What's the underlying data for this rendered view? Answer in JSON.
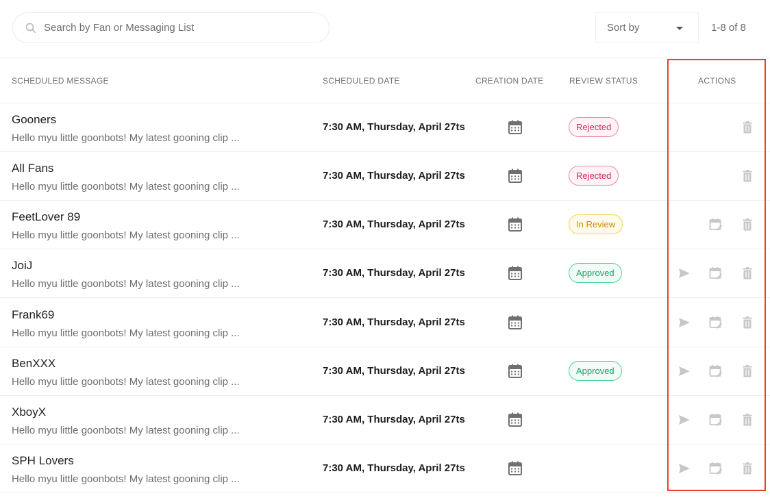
{
  "search": {
    "placeholder": "Search by Fan or Messaging List",
    "value": ""
  },
  "sort": {
    "label": "Sort by"
  },
  "pagination": {
    "text": "1-8 of 8"
  },
  "columns": {
    "message": "SCHEDULED MESSAGE",
    "scheduled_date": "SCHEDULED DATE",
    "creation_date": "CREATION DATE",
    "review_status": "REVIEW STATUS",
    "actions": "ACTIONS"
  },
  "icons": {
    "search": "search-icon",
    "sort": "chevron-down-icon",
    "creation": "calendar-icon",
    "send": "send-icon",
    "reschedule": "calendar-edit-icon",
    "delete": "trash-icon"
  },
  "colors": {
    "rejected": "#d2265a",
    "in_review": "#c98a00",
    "approved": "#12a46a",
    "highlight": "#e8402d",
    "action_icon": "#c7c7c7"
  },
  "rows": [
    {
      "name": "Gooners",
      "message": "Hello myu little goonbots! My latest gooning clip ...",
      "scheduled_date": "7:30 AM, Thursday, April 27ts",
      "status": "Rejected",
      "actions": [
        "trash"
      ]
    },
    {
      "name": "All Fans",
      "message": "Hello myu little goonbots! My latest gooning clip ...",
      "scheduled_date": "7:30 AM, Thursday, April 27ts",
      "status": "Rejected",
      "actions": [
        "trash"
      ]
    },
    {
      "name": "FeetLover 89",
      "message": "Hello myu little goonbots! My latest gooning clip ...",
      "scheduled_date": "7:30 AM, Thursday, April 27ts",
      "status": "In Review",
      "actions": [
        "schedule",
        "trash"
      ]
    },
    {
      "name": "JoiJ",
      "message": "Hello myu little goonbots! My latest gooning clip ...",
      "scheduled_date": "7:30 AM, Thursday, April 27ts",
      "status": "Approved",
      "actions": [
        "send",
        "schedule",
        "trash"
      ]
    },
    {
      "name": "Frank69",
      "message": "Hello myu little goonbots! My latest gooning clip ...",
      "scheduled_date": "7:30 AM, Thursday, April 27ts",
      "status": "",
      "actions": [
        "send",
        "schedule",
        "trash"
      ]
    },
    {
      "name": "BenXXX",
      "message": "Hello myu little goonbots! My latest gooning clip ...",
      "scheduled_date": "7:30 AM, Thursday, April 27ts",
      "status": "Approved",
      "actions": [
        "send",
        "schedule",
        "trash"
      ]
    },
    {
      "name": "XboyX",
      "message": "Hello myu little goonbots! My latest gooning clip ...",
      "scheduled_date": "7:30 AM, Thursday, April 27ts",
      "status": "",
      "actions": [
        "send",
        "schedule",
        "trash"
      ]
    },
    {
      "name": "SPH Lovers",
      "message": "Hello myu little goonbots! My latest gooning clip ...",
      "scheduled_date": "7:30 AM, Thursday, April 27ts",
      "status": "",
      "actions": [
        "send",
        "schedule",
        "trash"
      ]
    }
  ]
}
